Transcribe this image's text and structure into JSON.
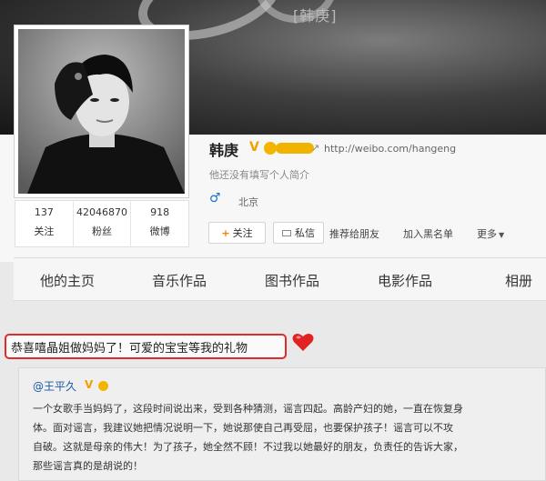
{
  "banner": {
    "tag": "[韩庚]"
  },
  "stats": [
    {
      "value": "137",
      "label": "关注"
    },
    {
      "value": "42046870",
      "label": "粉丝"
    },
    {
      "value": "918",
      "label": "微博"
    }
  ],
  "profile": {
    "name": "韩庚",
    "verified_mark": "V",
    "url": "http://weibo.com/hangeng",
    "intro": "他还没有填写个人简介",
    "gender_icon": "male-icon",
    "location": "北京"
  },
  "actions": {
    "follow": "关注",
    "message": "私信",
    "recommend": "推荐给朋友",
    "blacklist": "加入黑名单",
    "more": "更多"
  },
  "nav": {
    "tabs": [
      "他的主页",
      "音乐作品",
      "图书作品",
      "电影作品",
      "相册"
    ]
  },
  "post": {
    "text": "恭喜嘻晶姐做妈妈了！可爱的宝宝等我的礼物",
    "accent": "#e12b2b"
  },
  "quote": {
    "author": "@王平久",
    "verified_mark": "V",
    "lines": [
      "一个女歌手当妈妈了，这段时间说出来，受到各种猜测，谣言四起。高龄产妇的她，一直在恢复身",
      "体。面对谣言，我建议她把情况说明一下，她说那使自己再受屈，也要保护孩子！谣言可以不攻",
      "自破。这就是母亲的伟大！为了孩子，她全然不顾！不过我以她最好的朋友，负责任的告诉大家，",
      "那些谣言真的是胡说的！"
    ]
  }
}
